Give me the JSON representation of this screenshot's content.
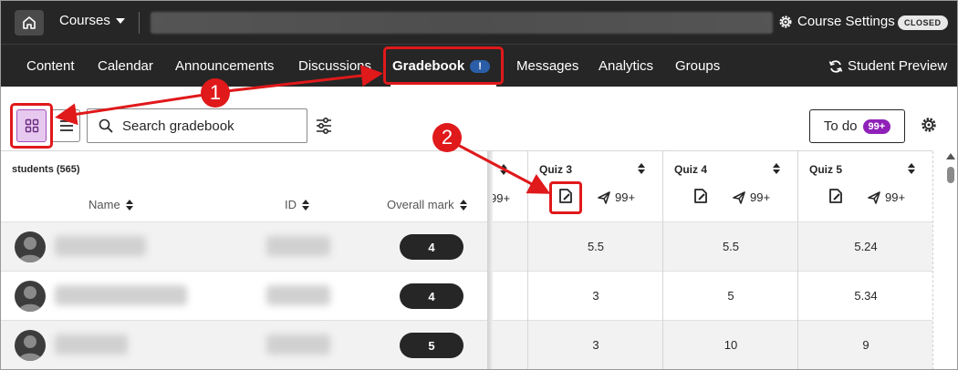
{
  "topbar": {
    "courses_label": "Courses",
    "course_settings_label": "Course Settings",
    "closed_badge": "CLOSED"
  },
  "nav": {
    "items": [
      "Content",
      "Calendar",
      "Announcements",
      "Discussions",
      "Gradebook",
      "Messages",
      "Analytics",
      "Groups"
    ],
    "active": "Gradebook",
    "gradebook_badge": "!",
    "student_preview": "Student Preview"
  },
  "toolbar": {
    "search_placeholder": "Search gradebook",
    "todo_label": "To do",
    "todo_badge": "99+"
  },
  "table": {
    "students_label": "students (565)",
    "columns": {
      "name": "Name",
      "id": "ID",
      "overall": "Overall mark"
    },
    "partial_count": "99+",
    "quizzes": [
      {
        "title": "Quiz 3",
        "count": "99+"
      },
      {
        "title": "Quiz 4",
        "count": "99+"
      },
      {
        "title": "Quiz 5",
        "count": "99+"
      }
    ],
    "rows": [
      {
        "overall": "4",
        "grades": [
          "5.5",
          "5.5",
          "5.24"
        ]
      },
      {
        "overall": "4",
        "grades": [
          "3",
          "5",
          "5.34"
        ]
      },
      {
        "overall": "5",
        "grades": [
          "3",
          "10",
          "9"
        ]
      }
    ]
  },
  "annotations": {
    "step1": "1",
    "step2": "2"
  },
  "colors": {
    "highlight_red": "#e0191b",
    "todo_purple": "#8f21b8",
    "badge_blue": "#2b5ea7",
    "topbar_bg": "#262626"
  }
}
